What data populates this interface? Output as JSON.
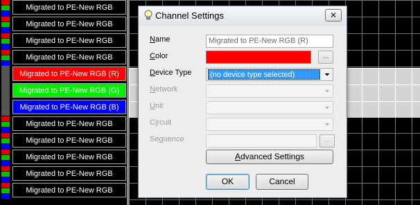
{
  "channel_list": {
    "rows": [
      {
        "label": "Migrated to PE-New RGB",
        "style": "black",
        "indicator": "rgb"
      },
      {
        "label": "Migrated to PE-New RGB",
        "style": "black",
        "indicator": "rgb"
      },
      {
        "label": "Migrated to PE-New RGB",
        "style": "black",
        "indicator": "rgb"
      },
      {
        "label": "Migrated to PE-New RGB",
        "style": "black",
        "indicator": "rgb"
      },
      {
        "label": "Migrated to PE-New RGB (R)",
        "style": "red",
        "indicator": "none"
      },
      {
        "label": "Migrated to PE-New RGB (G)",
        "style": "green",
        "indicator": "none"
      },
      {
        "label": "Migrated to PE-New RGB (B)",
        "style": "blue",
        "indicator": "none"
      },
      {
        "label": "Migrated to PE-New RGB",
        "style": "black",
        "indicator": "rgb"
      },
      {
        "label": "Migrated to PE-New RGB",
        "style": "black",
        "indicator": "rgb"
      },
      {
        "label": "Migrated to PE-New RGB",
        "style": "black",
        "indicator": "rgb"
      },
      {
        "label": "Migrated to PE-New RGB",
        "style": "black",
        "indicator": "rgb"
      },
      {
        "label": "Migrated to PE-New RGB",
        "style": "black",
        "indicator": "rgb"
      }
    ]
  },
  "dialog": {
    "title": "Channel Settings",
    "title_icon": "lightbulb-icon",
    "close_glyph": "✕",
    "fields": {
      "name": {
        "label_html": "Name",
        "value": "Migrated to PE-New RGB (R)"
      },
      "color": {
        "label": "Color",
        "value": "#ff0000",
        "button": "..."
      },
      "device_type": {
        "label": "Device Type",
        "value": "(no device type selected)"
      },
      "network": {
        "label": "Network",
        "value": ""
      },
      "unit": {
        "label": "Unit",
        "value": ""
      },
      "circuit": {
        "label": "Circuit",
        "value": ""
      },
      "sequence": {
        "label": "Sequence",
        "value": "",
        "button": "..."
      }
    },
    "advanced_button": "Advanced Settings",
    "ok_button": "OK",
    "cancel_button": "Cancel"
  },
  "colors": {
    "accent_selection": "#3399ff",
    "selected_channel_red": "#ff0000",
    "selected_channel_green": "#00ee00",
    "selected_channel_blue": "#0000ff"
  }
}
